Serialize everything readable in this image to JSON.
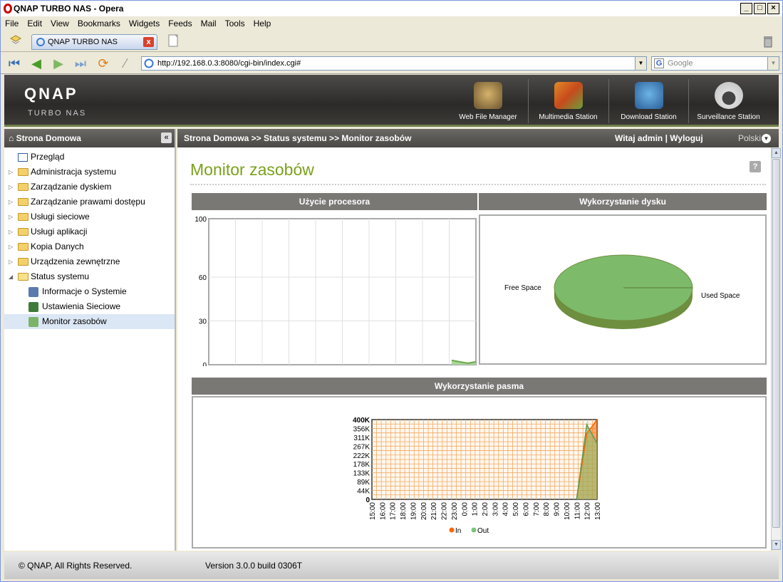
{
  "window": {
    "title": "QNAP TURBO NAS - Opera"
  },
  "menu": [
    "File",
    "Edit",
    "View",
    "Bookmarks",
    "Widgets",
    "Feeds",
    "Mail",
    "Tools",
    "Help"
  ],
  "tab": {
    "label": "QNAP TURBO NAS"
  },
  "address": {
    "url": "http://192.168.0.3:8080/cgi-bin/index.cgi#",
    "search_placeholder": "Google"
  },
  "header": {
    "logo": "QNAP",
    "sub": "TURBO NAS",
    "stations": [
      "Web File Manager",
      "Multimedia Station",
      "Download Station",
      "Surveillance Station"
    ]
  },
  "sidebar": {
    "title": "Strona Domowa",
    "items": [
      {
        "label": "Przegląd",
        "kind": "page"
      },
      {
        "label": "Administracja systemu",
        "kind": "folder"
      },
      {
        "label": "Zarządzanie dyskiem",
        "kind": "folder"
      },
      {
        "label": "Zarządzanie prawami dostępu",
        "kind": "folder"
      },
      {
        "label": "Usługi sieciowe",
        "kind": "folder"
      },
      {
        "label": "Usługi aplikacji",
        "kind": "folder"
      },
      {
        "label": "Kopia Danych",
        "kind": "folder"
      },
      {
        "label": "Urządzenia zewnętrzne",
        "kind": "folder"
      },
      {
        "label": "Status systemu",
        "kind": "folder-open"
      },
      {
        "label": "Informacje o Systemie",
        "kind": "child"
      },
      {
        "label": "Ustawienia Sieciowe",
        "kind": "child"
      },
      {
        "label": "Monitor zasobów",
        "kind": "child-selected"
      }
    ]
  },
  "main": {
    "breadcrumb": "Strona Domowa >> Status systemu >> Monitor zasobów",
    "welcome": "Witaj admin",
    "logout": "Wyloguj",
    "separator": "|",
    "language": "Polski",
    "title": "Monitor zasobów",
    "help": "?",
    "panels": {
      "cpu": "Użycie procesora",
      "disk": "Wykorzystanie dysku",
      "bandwidth": "Wykorzystanie pasma"
    }
  },
  "footer": {
    "copyright": "© QNAP, All Rights Reserved.",
    "version": "Version 3.0.0 build 0306T"
  },
  "chart_data": [
    {
      "type": "area",
      "yticks": [
        0,
        30,
        60,
        100
      ],
      "ylim": [
        0,
        100
      ],
      "series": [
        {
          "values": [
            0,
            0,
            0,
            0,
            0,
            0,
            0,
            0,
            0,
            0,
            0,
            0,
            0,
            0,
            0,
            0,
            0,
            0,
            0,
            0,
            0,
            0,
            0,
            0,
            0,
            0,
            0,
            1,
            2,
            1,
            3,
            2,
            1,
            2
          ]
        }
      ],
      "colors": {
        "series": "#6ca94b",
        "grid": "#e0e0e0"
      }
    },
    {
      "type": "pie",
      "labels": [
        "Free Space",
        "Used Space"
      ],
      "values": [
        99.9,
        0.1
      ],
      "colors": [
        "#7dbb6a",
        "#6e8f3f"
      ]
    },
    {
      "type": "area",
      "categories": [
        "15:00",
        "16:00",
        "17:00",
        "18:00",
        "19:00",
        "20:00",
        "21:00",
        "22:00",
        "23:00",
        "0:00",
        "1:00",
        "2:00",
        "3:00",
        "4:00",
        "5:00",
        "6:00",
        "7:00",
        "8:00",
        "9:00",
        "10:00",
        "11:00",
        "12:00",
        "13:00"
      ],
      "yticks": [
        "0",
        "44K",
        "89K",
        "133K",
        "178K",
        "222K",
        "267K",
        "311K",
        "356K",
        "400K"
      ],
      "ylim": [
        0,
        400000
      ],
      "series": [
        {
          "name": "In",
          "values": [
            0,
            0,
            0,
            0,
            0,
            0,
            0,
            0,
            0,
            0,
            0,
            0,
            0,
            0,
            0,
            0,
            0,
            0,
            0,
            0,
            0,
            330000,
            400000
          ]
        },
        {
          "name": "Out",
          "values": [
            0,
            0,
            0,
            0,
            0,
            0,
            0,
            0,
            0,
            0,
            0,
            0,
            0,
            0,
            0,
            0,
            0,
            0,
            0,
            0,
            0,
            375000,
            280000
          ]
        }
      ],
      "colors": {
        "In": "#ff6600",
        "Out": "#7ec47a",
        "grid": "#f3a860",
        "bg": "#fff8ef"
      }
    }
  ]
}
